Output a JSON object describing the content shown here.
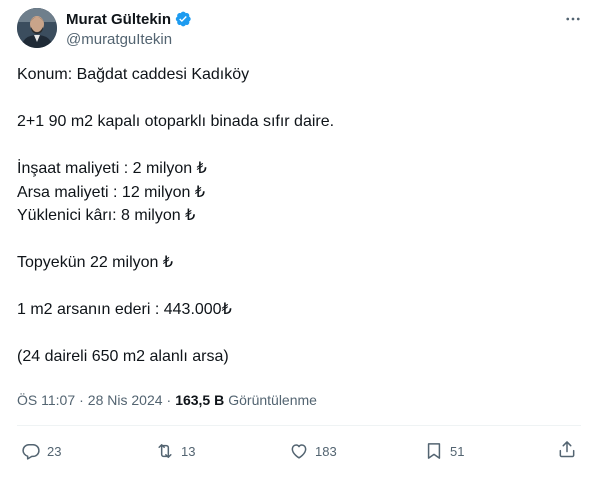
{
  "author": {
    "display_name": "Murat Gültekin",
    "handle": "@muratguItekin",
    "verified": true,
    "verified_color": "#1d9bf0"
  },
  "tweet": {
    "lines": [
      "Konum: Bağdat caddesi Kadıköy",
      "",
      "2+1 90 m2 kapalı otoparklı binada sıfır daire.",
      "",
      "İnşaat maliyeti : 2 milyon ₺",
      "Arsa maliyeti : 12 milyon ₺",
      "Yüklenici kârı: 8 milyon ₺",
      "",
      "Topyekün 22 milyon ₺",
      "",
      "1 m2 arsanın ederi : 443.000₺",
      "",
      "(24 daireli 650 m2 alanlı arsa)"
    ]
  },
  "meta": {
    "time": "ÖS 11:07",
    "date": "28 Nis 2024",
    "views_count": "163,5 B",
    "views_label": "Görüntülenme"
  },
  "actions": {
    "reply_count": "23",
    "retweet_count": "13",
    "like_count": "183",
    "bookmark_count": "51"
  },
  "colors": {
    "text": "#0f1419",
    "secondary": "#536471",
    "divider": "#eff3f4",
    "accent": "#1d9bf0"
  },
  "icons": {
    "verified": "verified-badge-icon",
    "more": "more-dots-icon",
    "reply": "reply-icon",
    "retweet": "retweet-icon",
    "like": "heart-icon",
    "bookmark": "bookmark-icon",
    "share": "share-icon"
  }
}
